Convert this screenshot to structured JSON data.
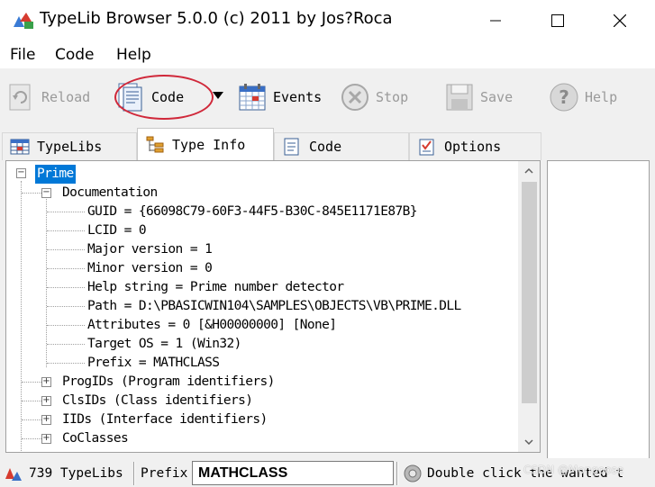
{
  "window": {
    "title": "TypeLib Browser 5.0.0 (c) 2011 by Jos?Roca",
    "minimize_glyph": "—",
    "maximize_glyph": "☐",
    "close_glyph": "✕"
  },
  "menu": {
    "items": [
      {
        "label": "File"
      },
      {
        "label": "Code"
      },
      {
        "label": "Help"
      }
    ]
  },
  "toolbar": {
    "reload_label": "Reload",
    "code_label": "Code",
    "events_label": "Events",
    "stop_label": "Stop",
    "save_label": "Save",
    "help_label": "Help",
    "dropdown_glyph": "▼"
  },
  "tabs": [
    {
      "label": "TypeLibs",
      "icon": "grid-icon"
    },
    {
      "label": "Type Info",
      "icon": "tree-icon"
    },
    {
      "label": "Code",
      "icon": "document-icon"
    },
    {
      "label": "Options",
      "icon": "checklist-icon"
    }
  ],
  "active_tab": "Type Info",
  "tree": {
    "root_label": "Prime",
    "documentation_label": "Documentation",
    "documentation_items": [
      "GUID = {66098C79-60F3-44F5-B30C-845E1171E87B}",
      "LCID = 0",
      "Major version = 1",
      "Minor version = 0",
      "Help string = Prime number detector",
      "Path = D:\\PBASICWIN104\\SAMPLES\\OBJECTS\\VB\\PRIME.DLL",
      "Attributes = 0 [&H00000000]  [None]",
      "Target OS = 1 (Win32)",
      "Prefix = MATHCLASS"
    ],
    "collapsed_nodes": [
      "ProgIDs (Program identifiers)",
      "ClsIDs (Class identifiers)",
      "IIDs (Interface identifiers)",
      "CoClasses"
    ]
  },
  "statusbar": {
    "typelib_count": "739 TypeLibs",
    "prefix_label": "Prefix",
    "prefix_value": "MATHCLASS",
    "hint": "Double click the wanted t"
  },
  "watermark": "CSDN @Mongoose",
  "colors": {
    "selection": "#0078d7",
    "highlight_ellipse": "#d0283a"
  }
}
